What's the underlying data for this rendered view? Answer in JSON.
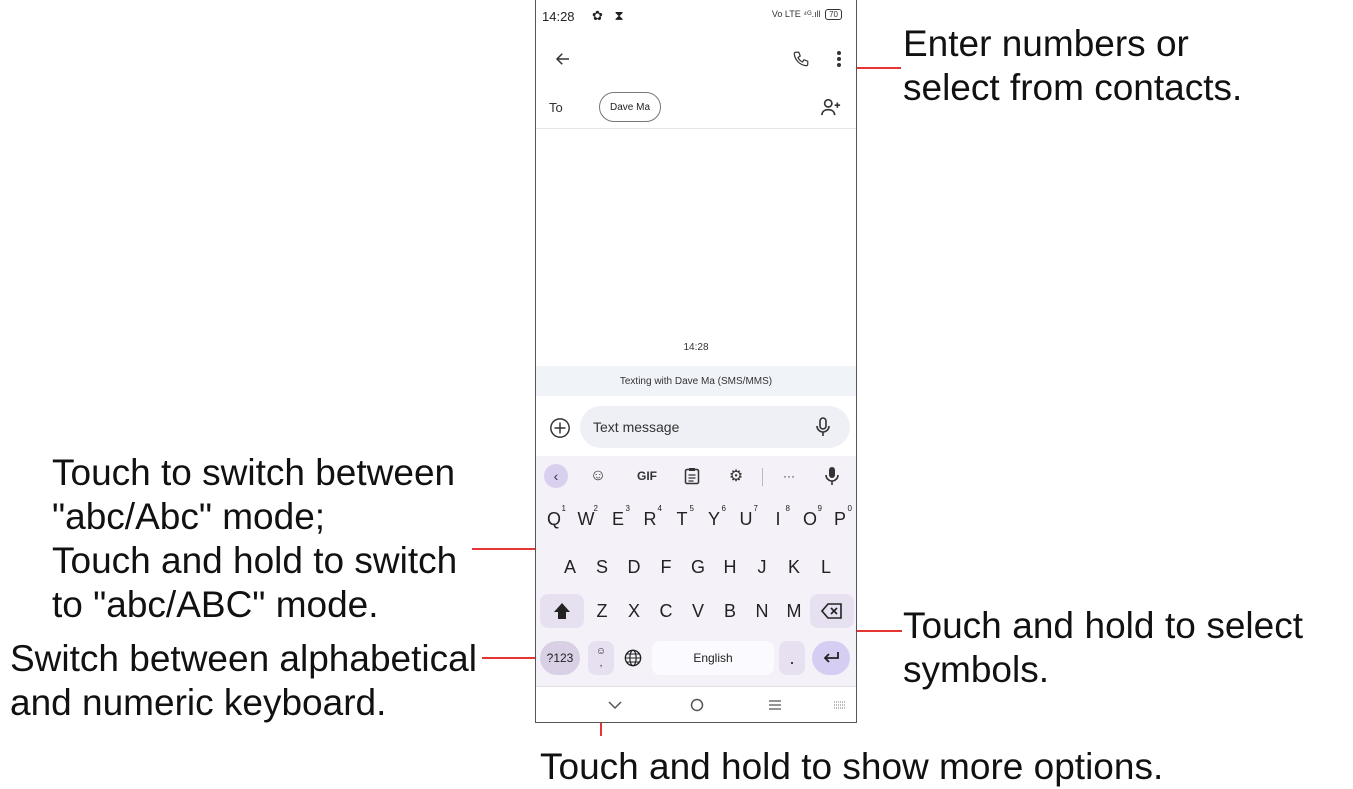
{
  "status_bar": {
    "time": "14:28",
    "icons": "✿ ⧗",
    "network": "Vo LTE ⁴ᴳ.ıll",
    "battery": "70"
  },
  "header": {
    "back_icon": "arrow-left-icon",
    "call_icon": "phone-icon",
    "menu_icon": "more-vert-icon"
  },
  "recipient": {
    "to_label": "To",
    "chip": "Dave Ma",
    "add_contact_icon": "add-person-icon"
  },
  "conversation": {
    "timestamp": "14:28",
    "texting_info": "Texting with Dave Ma (SMS/MMS)"
  },
  "compose": {
    "placeholder": "Text message"
  },
  "keyboard": {
    "toolbar": [
      "‹",
      "☺",
      "GIF",
      "📋",
      "⚙",
      "···",
      "🎙"
    ],
    "row1": [
      {
        "k": "Q",
        "n": "1"
      },
      {
        "k": "W",
        "n": "2"
      },
      {
        "k": "E",
        "n": "3"
      },
      {
        "k": "R",
        "n": "4"
      },
      {
        "k": "T",
        "n": "5"
      },
      {
        "k": "Y",
        "n": "6"
      },
      {
        "k": "U",
        "n": "7"
      },
      {
        "k": "I",
        "n": "8"
      },
      {
        "k": "O",
        "n": "9"
      },
      {
        "k": "P",
        "n": "0"
      }
    ],
    "row2": [
      "A",
      "S",
      "D",
      "F",
      "G",
      "H",
      "J",
      "K",
      "L"
    ],
    "row3": [
      "Z",
      "X",
      "C",
      "V",
      "B",
      "N",
      "M"
    ],
    "symbols_key": "?123",
    "comma": ",",
    "space_label": "English",
    "period": "."
  },
  "annotations": {
    "contacts": [
      "Enter numbers or",
      "select from contacts."
    ],
    "shift": [
      "Touch to switch between",
      "\"abc/Abc\" mode;",
      "Touch and hold to switch",
      "to \"abc/ABC\" mode."
    ],
    "numeric": [
      "Switch between alphabetical",
      "and numeric keyboard."
    ],
    "symbols": [
      "Touch and hold to select",
      "symbols."
    ],
    "more_options": "Touch and hold to show more options."
  }
}
